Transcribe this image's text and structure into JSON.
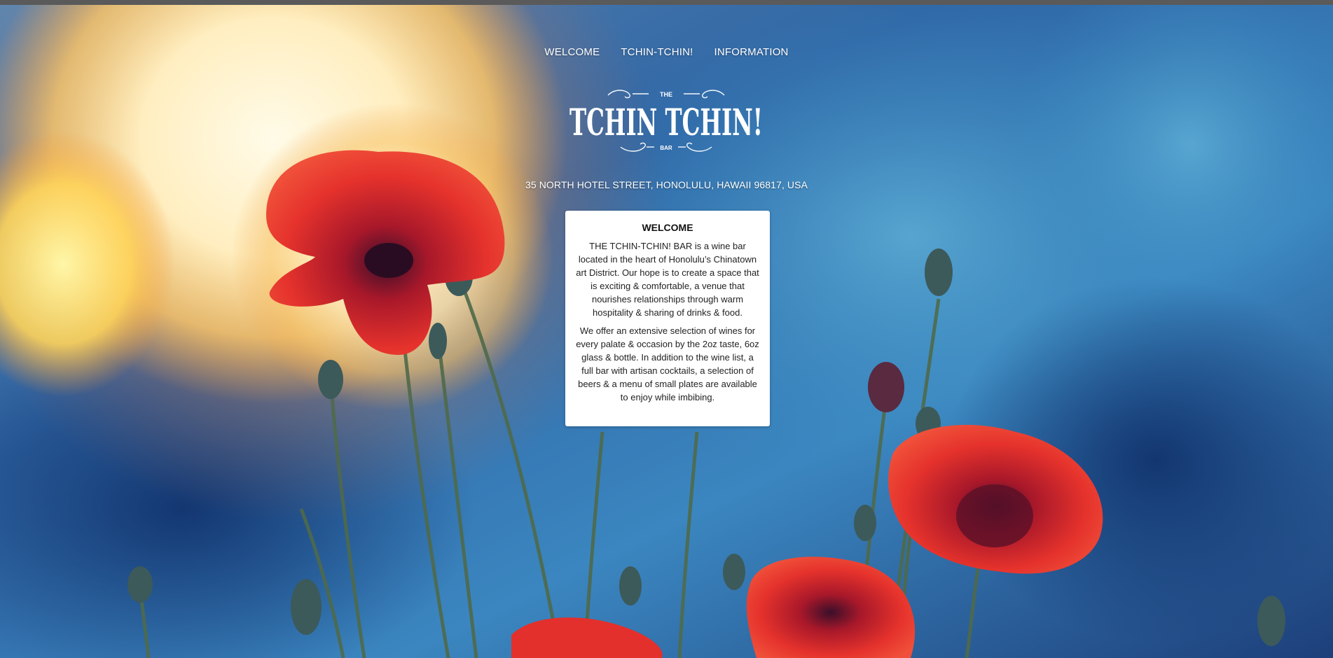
{
  "nav": {
    "items": [
      {
        "label": "WELCOME"
      },
      {
        "label": "TCHIN-TCHIN!"
      },
      {
        "label": "INFORMATION"
      }
    ]
  },
  "logo": {
    "top_text": "THE",
    "main_text": "TCHIN TCHIN!",
    "bottom_text": "BAR"
  },
  "address": "35 NORTH HOTEL STREET, HONOLULU, HAWAII 96817, USA",
  "welcome_card": {
    "title": "WELCOME",
    "paragraph_1": "THE TCHIN-TCHIN! BAR is a wine bar located in the heart of Honolulu’s Chinatown art District. Our hope is to create a space that is exciting & comfortable, a venue that nourishes relationships through warm hospitality & sharing of drinks & food.",
    "paragraph_2": "We offer an extensive selection of wines for every palate & occasion by the 2oz taste, 6oz glass & bottle. In addition to the wine list, a full bar with artisan cocktails, a selection of beers & a menu of small plates are available to enjoy while imbibing."
  },
  "colors": {
    "background_blue": "#1f4f86",
    "poppy_red": "#e5322c",
    "sun_glow": "#fff2c8",
    "card_bg": "#ffffff"
  }
}
